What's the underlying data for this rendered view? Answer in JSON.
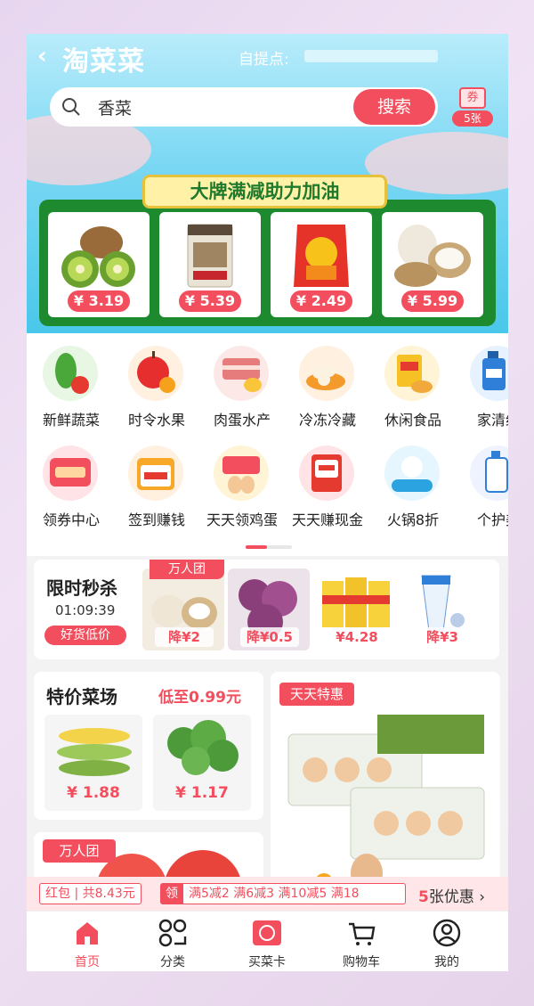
{
  "header": {
    "back_label": "‹",
    "title": "淘菜菜",
    "pickup_label": "自提点:"
  },
  "search": {
    "value": "香菜",
    "button": "搜索"
  },
  "coupon": {
    "top": "券",
    "count": "5张"
  },
  "banner": {
    "title": "大牌满减助力加油",
    "products": [
      {
        "name": "kiwi",
        "price": "¥ 3.19"
      },
      {
        "name": "biscuits",
        "price": "¥ 5.39"
      },
      {
        "name": "snack",
        "price": "¥ 2.49"
      },
      {
        "name": "coconut",
        "price": "¥ 5.99"
      }
    ]
  },
  "categories": [
    {
      "label": "新鲜蔬菜",
      "icon": "vegetable-icon",
      "color": "#e8f6e4"
    },
    {
      "label": "时令水果",
      "icon": "apple-icon",
      "color": "#fff0e0"
    },
    {
      "label": "肉蛋水产",
      "icon": "meat-icon",
      "color": "#fde8e8"
    },
    {
      "label": "冷冻冷藏",
      "icon": "dumpling-icon",
      "color": "#fff0e0"
    },
    {
      "label": "休闲食品",
      "icon": "snack-icon",
      "color": "#fff4d6"
    },
    {
      "label": "家清纸",
      "icon": "detergent-icon",
      "color": "#e6f2ff"
    },
    {
      "label": "领券中心",
      "icon": "coupon-center-icon",
      "color": "#ffe3e6"
    },
    {
      "label": "签到赚钱",
      "icon": "checkin-icon",
      "color": "#fff0e0"
    },
    {
      "label": "天天领鸡蛋",
      "icon": "egg-icon",
      "color": "#fff4d6"
    },
    {
      "label": "天天赚现金",
      "icon": "cash-icon",
      "color": "#ffe3e6"
    },
    {
      "label": "火锅8折",
      "icon": "hotpot-icon",
      "color": "#e6f6ff"
    },
    {
      "label": "个护美",
      "icon": "personal-care-icon",
      "color": "#eef3ff"
    }
  ],
  "flash": {
    "title": "限时秒杀",
    "time": "01:09:39",
    "tag": "好货低价",
    "group": "万人团",
    "items": [
      {
        "discount": "降¥2"
      },
      {
        "discount": "降¥0.5"
      },
      {
        "discount": "¥4.28"
      },
      {
        "discount": "降¥3"
      }
    ]
  },
  "special": {
    "title": "特价菜场",
    "subtitle": "低至0.99元",
    "items": [
      {
        "price": "¥ 1.88"
      },
      {
        "price": "¥ 1.17"
      }
    ]
  },
  "daily": {
    "tag": "天天特惠"
  },
  "group_card": {
    "tag": "万人团"
  },
  "coupon_bar": {
    "redpacket": "红包 | 共8.43元",
    "ling": "领",
    "rules": "满5减2  满6减3  满10减5  满18",
    "count": "5",
    "suffix": "张优惠 ›"
  },
  "tabbar": [
    {
      "label": "首页",
      "icon": "home-icon"
    },
    {
      "label": "分类",
      "icon": "category-icon"
    },
    {
      "label": "买菜卡",
      "icon": "card-icon"
    },
    {
      "label": "购物车",
      "icon": "cart-icon"
    },
    {
      "label": "我的",
      "icon": "user-icon"
    }
  ],
  "colors": {
    "accent": "#f24e5d",
    "green": "#1e8a2f"
  }
}
